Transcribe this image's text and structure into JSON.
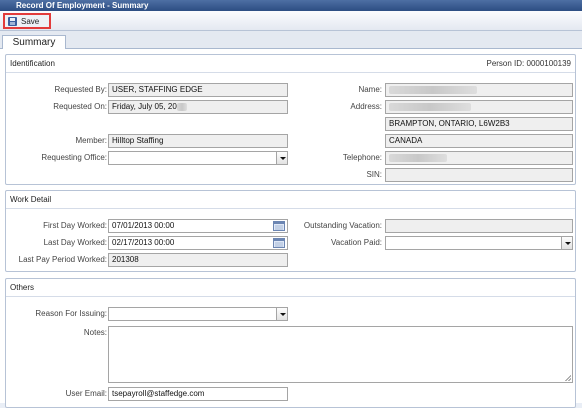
{
  "window": {
    "title": "Record Of Employment - Summary"
  },
  "toolbar": {
    "save_label": "Save",
    "save_icon": "floppy-disk-icon"
  },
  "tabs": [
    {
      "label": "Summary",
      "active": true
    }
  ],
  "identification": {
    "title": "Identification",
    "person_id": "Person ID: 0000100139",
    "requested_by_label": "Requested By:",
    "requested_by_value": "USER, STAFFING EDGE",
    "requested_on_label": "Requested On:",
    "requested_on_value": "Friday, July 05, 20",
    "member_label": "Member:",
    "member_value": "Hilltop Staffing",
    "requesting_office_label": "Requesting Office:",
    "requesting_office_value": "",
    "name_label": "Name:",
    "address_label": "Address:",
    "address_line2": "BRAMPTON, ONTARIO, L6W2B3",
    "address_line3": "CANADA",
    "telephone_label": "Telephone:",
    "sin_label": "SIN:"
  },
  "work_detail": {
    "title": "Work Detail",
    "first_day_label": "First Day Worked:",
    "first_day_value": "07/01/2013 00:00",
    "last_day_label": "Last Day Worked:",
    "last_day_value": "02/17/2013 00:00",
    "last_pay_period_label": "Last Pay Period Worked:",
    "last_pay_period_value": "201308",
    "outstanding_vacation_label": "Outstanding Vacation:",
    "vacation_paid_label": "Vacation Paid:"
  },
  "others": {
    "title": "Others",
    "reason_label": "Reason For Issuing:",
    "notes_label": "Notes:",
    "user_email_label": "User Email:",
    "user_email_value": "tsepayroll@staffedge.com"
  }
}
